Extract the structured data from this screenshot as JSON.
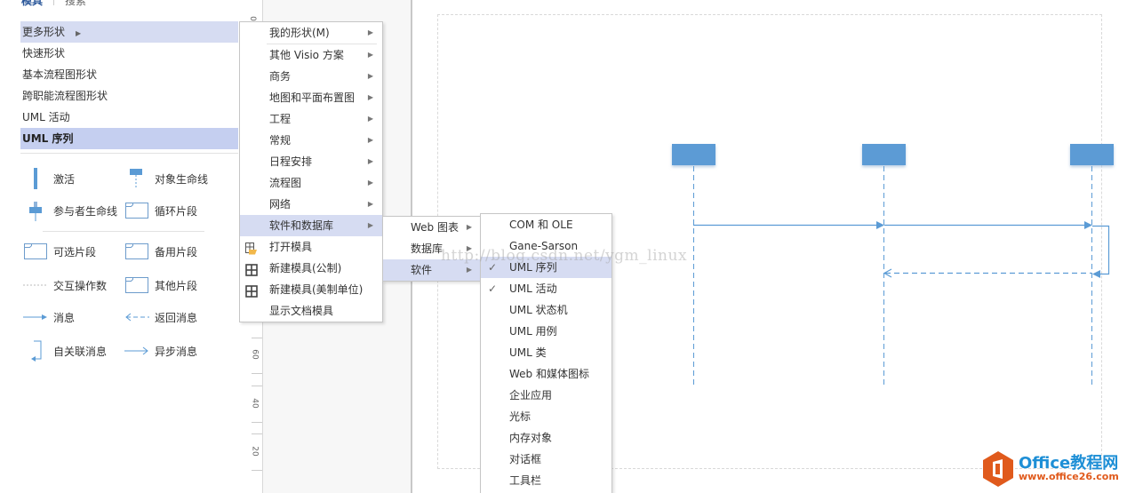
{
  "pane": {
    "tabs": [
      "模具",
      "搜索"
    ],
    "stencils": [
      {
        "label": "更多形状",
        "has_submenu": true
      },
      {
        "label": "快速形状"
      },
      {
        "label": "基本流程图形状"
      },
      {
        "label": "跨职能流程图形状"
      },
      {
        "label": "UML 活动"
      },
      {
        "label": "UML 序列",
        "selected": true
      }
    ],
    "shapes": [
      {
        "label": "激活",
        "icon": "activation-icon"
      },
      {
        "label": "对象生命线",
        "icon": "object-lifeline-icon"
      },
      {
        "label": "参与者生命线",
        "icon": "actor-lifeline-icon"
      },
      {
        "label": "循环片段",
        "icon": "loop-fragment-icon"
      },
      {
        "label": "可选片段",
        "icon": "optional-fragment-icon"
      },
      {
        "label": "备用片段",
        "icon": "alt-fragment-icon"
      },
      {
        "label": "交互操作数",
        "icon": "interaction-operand-icon"
      },
      {
        "label": "其他片段",
        "icon": "other-fragment-icon"
      },
      {
        "label": "消息",
        "icon": "message-arrow-icon"
      },
      {
        "label": "返回消息",
        "icon": "return-message-icon"
      },
      {
        "label": "自关联消息",
        "icon": "self-message-icon"
      },
      {
        "label": "异步消息",
        "icon": "async-message-icon"
      }
    ]
  },
  "ruler": {
    "labels": [
      "0",
      "60",
      "40",
      "20"
    ]
  },
  "menu1": {
    "items": [
      {
        "label": "我的形状(M)",
        "submenu": true
      },
      {
        "label": "其他 Visio 方案",
        "submenu": true
      },
      {
        "label": "商务",
        "submenu": true
      },
      {
        "label": "地图和平面布置图",
        "submenu": true
      },
      {
        "label": "工程",
        "submenu": true
      },
      {
        "label": "常规",
        "submenu": true
      },
      {
        "label": "日程安排",
        "submenu": true
      },
      {
        "label": "流程图",
        "submenu": true
      },
      {
        "label": "网络",
        "submenu": true
      },
      {
        "label": "软件和数据库",
        "submenu": true,
        "highlighted": true
      },
      {
        "label": "打开模具",
        "icon": "open-stencil-icon"
      },
      {
        "label": "新建模具(公制)",
        "icon": "new-stencil-icon"
      },
      {
        "label": "新建模具(美制单位)",
        "icon": "new-stencil-icon"
      },
      {
        "label": "显示文档模具"
      }
    ]
  },
  "menu2": {
    "items": [
      {
        "label": "Web 图表",
        "submenu": true
      },
      {
        "label": "数据库",
        "submenu": true
      },
      {
        "label": "软件",
        "submenu": true,
        "highlighted": true
      }
    ]
  },
  "menu3": {
    "items": [
      {
        "label": "COM 和 OLE"
      },
      {
        "label": "Gane-Sarson"
      },
      {
        "label": "UML 序列",
        "checked": true,
        "highlighted": true
      },
      {
        "label": "UML 活动",
        "checked": true
      },
      {
        "label": "UML 状态机"
      },
      {
        "label": "UML 用例"
      },
      {
        "label": "UML 类"
      },
      {
        "label": "Web 和媒体图标"
      },
      {
        "label": "企业应用"
      },
      {
        "label": "光标"
      },
      {
        "label": "内存对象"
      },
      {
        "label": "对话框"
      },
      {
        "label": "工具栏"
      }
    ]
  },
  "symbols": {
    "submenu_arrow": "▶",
    "check": "✓"
  },
  "watermark": "http://blog.csdn.net/ygm_linux",
  "logo": {
    "brand": "Office教程网",
    "url": "www.office26.com"
  },
  "colors": {
    "accent": "#5b9bd5",
    "menu_highlight": "#d6dcf2",
    "logo_orange": "#e05a1c",
    "logo_blue": "#1e8fd6"
  }
}
